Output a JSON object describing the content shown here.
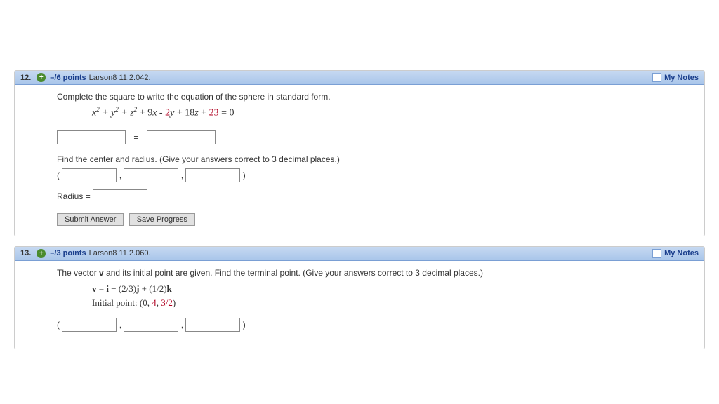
{
  "q12": {
    "number": "12.",
    "points": "–/6 points",
    "ref": "Larson8 11.2.042.",
    "mynotes_label": "My Notes",
    "prompt": "Complete the square to write the equation of the sphere in standard form.",
    "eq_prefix_x": "x",
    "eq_prefix_y": "y",
    "eq_prefix_z": "z",
    "eq_rest_a": " + 9",
    "eq_rest_b": " - ",
    "eq_2y": "2",
    "eq_rest_c": " + 18",
    "eq_rest_d": " + ",
    "eq_23": "23",
    "eq_rest_e": " = 0",
    "equals": "=",
    "subprompt": "Find the center and radius. (Give your answers correct to 3 decimal places.)",
    "open": "(",
    "comma": ",",
    "close": ")",
    "radius_label": "Radius =",
    "submit": "Submit Answer",
    "save": "Save Progress"
  },
  "q13": {
    "number": "13.",
    "points": "–/3 points",
    "ref": "Larson8 11.2.060.",
    "mynotes_label": "My Notes",
    "prompt": "The vector v and its initial point are given. Find the terminal point. (Give your answers correct to 3 decimal places.)",
    "vec_line": "v = i − (2/3)j + (1/2)k",
    "init_prefix": "Initial point: (0, ",
    "init_4": "4",
    "init_mid": ", ",
    "init_32": "3/2",
    "init_suffix": ")",
    "open": "(",
    "comma": ",",
    "close": ")"
  }
}
